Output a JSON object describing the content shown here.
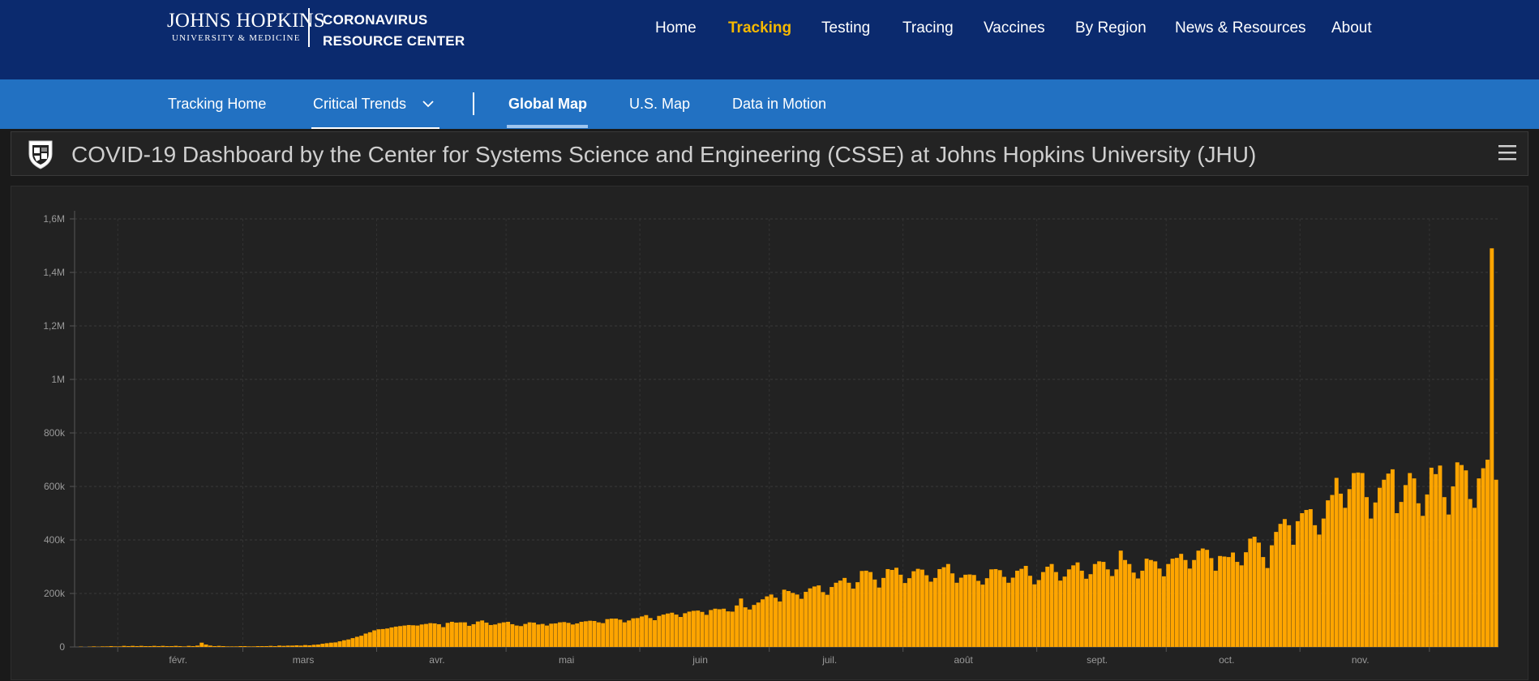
{
  "header": {
    "logo_name": "JOHNS HOPKINS",
    "logo_sub": "UNIVERSITY & MEDICINE",
    "site_title_line1": "CORONAVIRUS",
    "site_title_line2": "RESOURCE CENTER",
    "nav": [
      "Home",
      "Tracking",
      "Testing",
      "Tracing",
      "Vaccines",
      "By Region",
      "News & Resources",
      "About"
    ],
    "active_nav": "Tracking",
    "active_color": "#f5b800",
    "bg_color": "#0b2a6e"
  },
  "subnav": {
    "items": [
      "Tracking Home",
      "Critical Trends",
      "Global Map",
      "U.S. Map",
      "Data in Motion"
    ],
    "active": "Global Map",
    "bg_color": "#2271c2"
  },
  "dashboard": {
    "title": "COVID-19 Dashboard by the Center for Systems Science and Engineering (CSSE) at Johns Hopkins University (JHU)",
    "icons": [
      "jhu-shield-icon",
      "hamburger-menu-icon"
    ]
  },
  "chart_data": {
    "type": "bar",
    "title": "",
    "xlabel": "",
    "ylabel": "",
    "bar_color": "#ffa500",
    "ylim": [
      0,
      1600000
    ],
    "yticks": [
      "0",
      "200k",
      "400k",
      "600k",
      "800k",
      "1M",
      "1,2M",
      "1,4M",
      "1,6M"
    ],
    "ytick_values": [
      0,
      200000,
      400000,
      600000,
      800000,
      1000000,
      1200000,
      1400000,
      1600000
    ],
    "xtick_labels": [
      "févr.",
      "mars",
      "avr.",
      "mai",
      "juin",
      "juil.",
      "août",
      "sept.",
      "oct.",
      "nov."
    ],
    "xtick_positions_day": [
      9,
      38,
      69,
      99,
      130,
      160,
      191,
      222,
      252,
      283
    ],
    "start_date": "2020-01-22",
    "grid": true,
    "values": [
      0,
      1000,
      0,
      1000,
      2000,
      1000,
      2000,
      2000,
      3000,
      2000,
      2000,
      4000,
      3000,
      4000,
      3000,
      4000,
      3000,
      3000,
      4000,
      3000,
      4000,
      3000,
      3000,
      4000,
      3000,
      2000,
      4000,
      3000,
      5000,
      16000,
      9000,
      5000,
      3000,
      4000,
      3000,
      2000,
      2000,
      2000,
      3000,
      3000,
      2000,
      2000,
      3000,
      3000,
      3000,
      4000,
      3000,
      5000,
      4000,
      5000,
      5000,
      6000,
      5000,
      7000,
      6000,
      8000,
      9000,
      12000,
      14000,
      16000,
      17000,
      21000,
      25000,
      28000,
      33000,
      38000,
      42000,
      50000,
      55000,
      62000,
      66000,
      67000,
      69000,
      73000,
      76000,
      78000,
      80000,
      82000,
      81000,
      80000,
      84000,
      86000,
      89000,
      88000,
      85000,
      74000,
      90000,
      94000,
      91000,
      92000,
      92000,
      79000,
      85000,
      95000,
      99000,
      91000,
      82000,
      84000,
      89000,
      92000,
      94000,
      85000,
      80000,
      78000,
      86000,
      92000,
      91000,
      84000,
      86000,
      80000,
      87000,
      88000,
      92000,
      93000,
      90000,
      84000,
      88000,
      94000,
      96000,
      98000,
      97000,
      92000,
      89000,
      104000,
      106000,
      106000,
      102000,
      92000,
      99000,
      107000,
      108000,
      114000,
      119000,
      108000,
      100000,
      116000,
      121000,
      125000,
      128000,
      121000,
      112000,
      126000,
      132000,
      135000,
      136000,
      131000,
      120000,
      138000,
      143000,
      141000,
      143000,
      133000,
      132000,
      155000,
      181000,
      148000,
      140000,
      157000,
      166000,
      178000,
      189000,
      196000,
      184000,
      170000,
      214000,
      209000,
      202000,
      196000,
      180000,
      206000,
      219000,
      226000,
      230000,
      205000,
      195000,
      224000,
      240000,
      248000,
      258000,
      240000,
      218000,
      242000,
      284000,
      285000,
      280000,
      252000,
      222000,
      258000,
      291000,
      288000,
      296000,
      270000,
      239000,
      257000,
      283000,
      292000,
      289000,
      268000,
      244000,
      258000,
      291000,
      298000,
      310000,
      275000,
      240000,
      259000,
      270000,
      271000,
      269000,
      247000,
      233000,
      257000,
      290000,
      291000,
      287000,
      262000,
      240000,
      259000,
      285000,
      292000,
      303000,
      266000,
      234000,
      250000,
      280000,
      300000,
      310000,
      280000,
      248000,
      263000,
      290000,
      305000,
      316000,
      285000,
      255000,
      272000,
      310000,
      320000,
      318000,
      290000,
      265000,
      290000,
      360000,
      325000,
      310000,
      278000,
      256000,
      285000,
      330000,
      325000,
      320000,
      293000,
      264000,
      310000,
      330000,
      333000,
      348000,
      325000,
      293000,
      325000,
      360000,
      368000,
      363000,
      332000,
      285000,
      340000,
      338000,
      336000,
      353000,
      318000,
      305000,
      354000,
      405000,
      412000,
      390000,
      336000,
      295000,
      380000,
      430000,
      460000,
      478000,
      455000,
      382000,
      470000,
      500000,
      512000,
      515000,
      455000,
      420000,
      480000,
      548000,
      568000,
      632000,
      573000,
      520000,
      590000,
      650000,
      652000,
      650000,
      560000,
      480000,
      540000,
      595000,
      625000,
      648000,
      664000,
      500000,
      542000,
      605000,
      650000,
      630000,
      537000,
      490000,
      570000,
      670000,
      646000,
      678000,
      560000,
      495000,
      600000,
      690000,
      680000,
      660000,
      553000,
      520000,
      630000,
      668000,
      700000,
      1490000,
      625000
    ]
  }
}
